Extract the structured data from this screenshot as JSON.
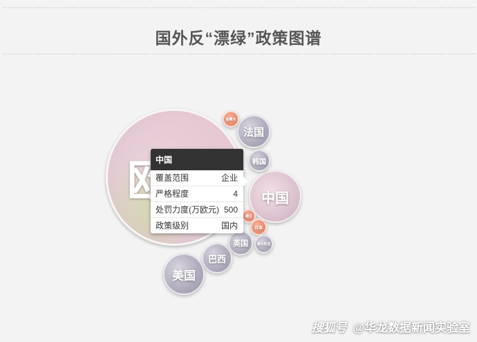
{
  "title": "国外反“漂绿”政策图谱",
  "bubbles": [
    {
      "label": "欧",
      "name": "bubble-eu"
    },
    {
      "label": "中国",
      "name": "bubble-china"
    },
    {
      "label": "法国",
      "name": "bubble-france"
    },
    {
      "label": "韩国",
      "name": "bubble-korea"
    },
    {
      "label": "加拿大",
      "name": "bubble-canada"
    },
    {
      "label": "英国",
      "name": "bubble-uk"
    },
    {
      "label": "日本",
      "name": "bubble-japan"
    },
    {
      "label": "澳大利亚",
      "name": "bubble-australia"
    },
    {
      "label": "巴西",
      "name": "bubble-brazil"
    },
    {
      "label": "美国",
      "name": "bubble-usa"
    },
    {
      "label": "荷兰",
      "name": "bubble-netherlands"
    }
  ],
  "tooltip": {
    "title": "中国",
    "rows": [
      {
        "label": "覆盖范围",
        "value": "企业"
      },
      {
        "label": "严格程度",
        "value": "4"
      },
      {
        "label": "处罚力度(万欧元)",
        "value": "500"
      },
      {
        "label": "政策级别",
        "value": "国内"
      }
    ]
  },
  "watermark": {
    "logo": "搜狐号",
    "text": "@华龙数据新闻实验室"
  }
}
